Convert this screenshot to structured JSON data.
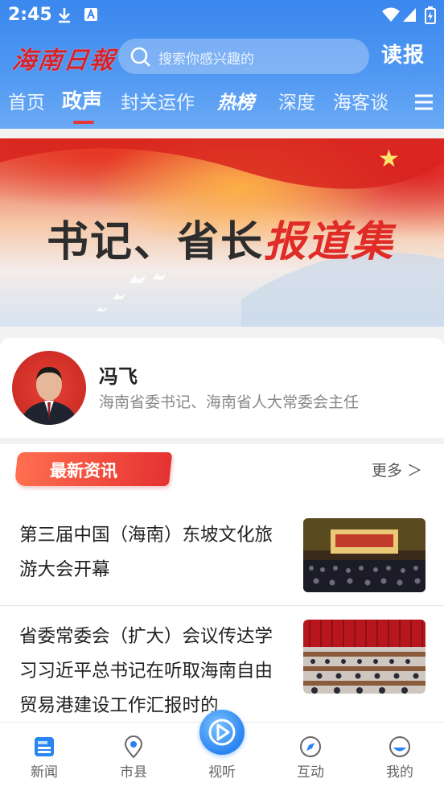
{
  "status_bar": {
    "time": "2:45"
  },
  "header": {
    "logo_text": "海南日報",
    "search_placeholder": "搜索你感兴趣的",
    "read_paper_label": "读报",
    "tabs": [
      {
        "label": "首页",
        "active": false
      },
      {
        "label": "政声",
        "active": true
      },
      {
        "label": "封关运作",
        "active": false
      },
      {
        "label": "热榜",
        "active": false
      },
      {
        "label": "深度",
        "active": false
      },
      {
        "label": "海客谈",
        "active": false
      }
    ]
  },
  "banner": {
    "title_black": "书记、省长",
    "title_red": "报道集"
  },
  "leader": {
    "name": "冯飞",
    "title": "海南省委书记、海南省人大常委会主任"
  },
  "news_section": {
    "title": "最新资讯",
    "more_label": "更多 ＞",
    "items": [
      {
        "title": "第三届中国（海南）东坡文化旅游大会开幕"
      },
      {
        "title": "省委常委会（扩大）会议传达学习习近平总书记在听取海南自由贸易港建设工作汇报时的"
      }
    ]
  },
  "bottom_nav": {
    "items": [
      {
        "label": "新闻",
        "icon": "news-icon",
        "active": true
      },
      {
        "label": "市县",
        "icon": "location-icon",
        "active": false
      },
      {
        "label": "视听",
        "icon": "play-icon",
        "active": false
      },
      {
        "label": "互动",
        "icon": "compass-icon",
        "active": false
      },
      {
        "label": "我的",
        "icon": "profile-icon",
        "active": false
      }
    ]
  },
  "colors": {
    "header_blue": "#3a87ee",
    "accent_red": "#e53232",
    "nav_blue": "#2a84f2"
  }
}
